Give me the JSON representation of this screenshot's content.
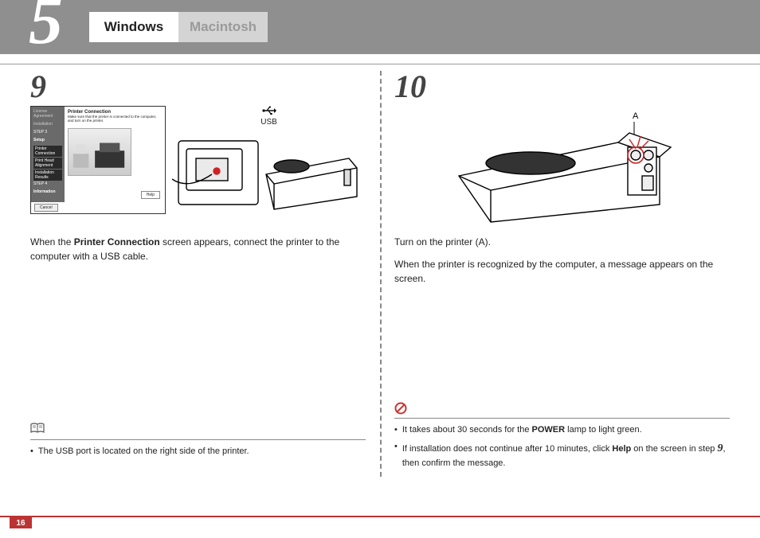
{
  "header": {
    "section_number": "5",
    "tabs": {
      "active": "Windows",
      "inactive": "Macintosh"
    }
  },
  "left": {
    "step_number": "9",
    "dialog": {
      "title": "Printer Connection",
      "subtitle": "Make sure that the printer is connected to the computer, and turn on the printer.",
      "side": {
        "i1": "License Agreement",
        "i2": "Installation",
        "s3": "STEP 3",
        "setup": "Setup",
        "a": "Printer Connection",
        "b": "Print Head Alignment",
        "c": "Installation Results",
        "s4": "STEP 4",
        "info": "Information"
      },
      "help": "Help",
      "cancel": "Cancel"
    },
    "usb_label": "USB",
    "body_prefix": "When the ",
    "body_bold": "Printer Connection",
    "body_suffix": " screen appears, connect the printer to the computer with a USB cable.",
    "note1": "The USB port is located on the right side of the printer."
  },
  "right": {
    "step_number": "10",
    "label_a": "A",
    "body1": "Turn on the printer (A).",
    "body2": "When the printer is recognized by the computer, a message appears on the screen.",
    "note1_prefix": "It takes about 30 seconds for the ",
    "note1_bold": "POWER",
    "note1_suffix": " lamp to light green.",
    "note2_prefix": "If installation does not continue after 10 minutes, click ",
    "note2_bold": "Help",
    "note2_mid": " on the screen in step ",
    "note2_step": "9",
    "note2_suffix": ", then confirm the message."
  },
  "page_number": "16"
}
